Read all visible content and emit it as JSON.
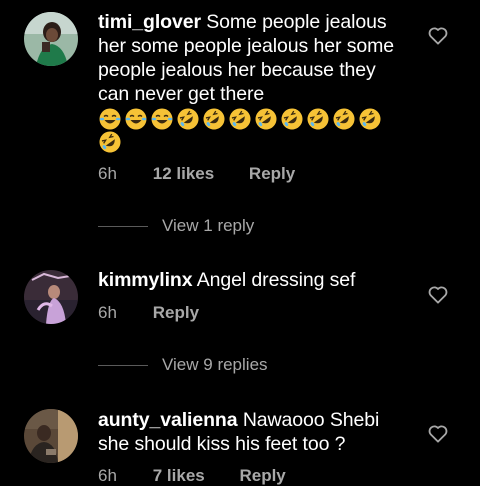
{
  "comments": [
    {
      "username": "timi_glover",
      "text": "Some people jealous her some people jealous her some people jealous her because they can never get there",
      "emojis": [
        "face-with-tears-of-joy",
        "face-with-tears-of-joy",
        "face-with-tears-of-joy",
        "rolling-on-floor-laughing",
        "rolling-on-floor-laughing",
        "rolling-on-floor-laughing",
        "rolling-on-floor-laughing",
        "rolling-on-floor-laughing",
        "rolling-on-floor-laughing",
        "rolling-on-floor-laughing",
        "rolling-on-floor-laughing",
        "rolling-on-floor-laughing"
      ],
      "time": "6h",
      "likes": "12 likes",
      "reply_label": "Reply",
      "view_replies": "View 1 reply"
    },
    {
      "username": "kimmylinx",
      "text": "Angel dressing sef",
      "time": "6h",
      "reply_label": "Reply",
      "view_replies": "View 9 replies"
    },
    {
      "username": "aunty_valienna",
      "text": "Nawaooo Shebi she should kiss his feet too ?",
      "time": "6h",
      "likes": "7 likes",
      "reply_label": "Reply"
    }
  ],
  "icons": {
    "like": "heart-outline-icon",
    "laugh": "face-with-tears-of-joy",
    "rofl": "rolling-on-floor-laughing"
  },
  "colors": {
    "background": "#000000",
    "text": "#ffffff",
    "secondary": "#a8a8a8",
    "emoji_yellow": "#f6c236"
  }
}
